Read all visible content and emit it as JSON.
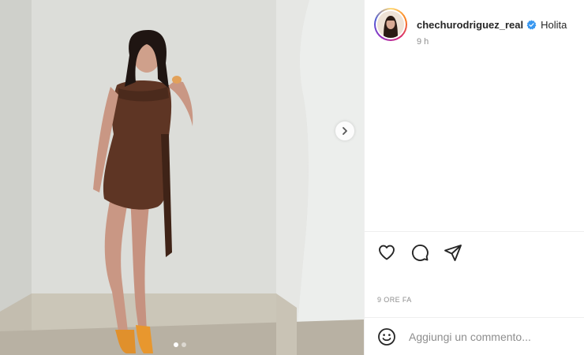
{
  "post": {
    "image_description_icon": "photo",
    "carousel": {
      "total": 2,
      "active": 1
    }
  },
  "header": {
    "username": "chechurodriguez_real",
    "caption": "Holita",
    "relative_time": "9 h",
    "verified": true
  },
  "actions": {
    "like_icon": "heart-icon",
    "comment_icon": "comment-icon",
    "share_icon": "share-icon"
  },
  "footer": {
    "date": "9 ORE FA",
    "comment_placeholder": "Aggiungi un commento..."
  },
  "colors": {
    "accent_verified": "#3897f0",
    "text_secondary": "#8e8e8e",
    "divider": "#efefef"
  }
}
